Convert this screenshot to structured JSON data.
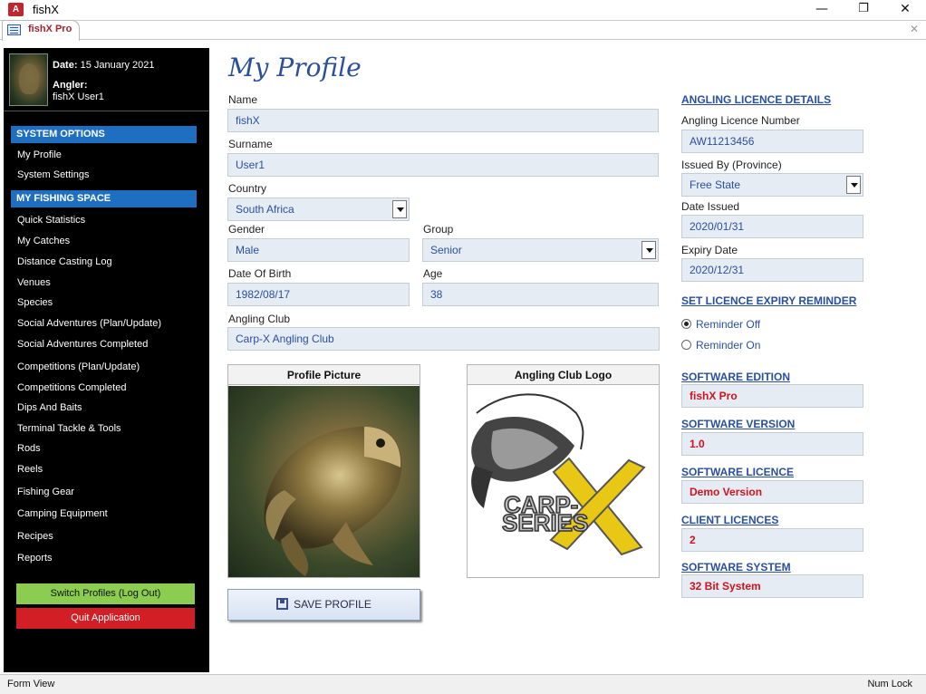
{
  "window": {
    "title": "fishX",
    "app_icon_letter": "A",
    "minimize": "—",
    "restore": "❐",
    "close": "✕"
  },
  "tab": {
    "label": "fishX Pro",
    "close": "✕"
  },
  "user": {
    "date_label": "Date:",
    "date": "15 January 2021",
    "angler_label": "Angler:",
    "angler_name": "fishX User1"
  },
  "sidebar": {
    "system_options": "SYSTEM OPTIONS",
    "system_items": [
      "My Profile",
      "System Settings"
    ],
    "fishing_space": "MY FISHING SPACE",
    "fishing_items": [
      "Quick Statistics",
      "My Catches",
      "Distance Casting Log",
      "Venues",
      "Species",
      "Social Adventures (Plan/Update)",
      "Social Adventures Completed",
      "Competitions (Plan/Update)",
      "Competitions Completed",
      "Dips And Baits",
      "Terminal Tackle & Tools",
      "Rods",
      "Reels",
      "Fishing Gear",
      "Camping Equipment",
      "Recipes",
      "Reports"
    ],
    "switch_label": "Switch Profiles (Log Out)",
    "quit_label": "Quit Application",
    "colors": {
      "section": "#1e6fc1",
      "switch": "#8ccc50",
      "quit": "#d21f26"
    }
  },
  "form": {
    "title": "My Profile",
    "name_label": "Name",
    "name": "fishX",
    "surname_label": "Surname",
    "surname": "User1",
    "country_label": "Country",
    "country": "South Africa",
    "gender_label": "Gender",
    "gender": "Male",
    "group_label": "Group",
    "group": "Senior",
    "dob_label": "Date Of Birth",
    "dob": "1982/08/17",
    "age_label": "Age",
    "age": "38",
    "club_label": "Angling Club",
    "club": "Carp-X Angling Club",
    "profile_picture_label": "Profile Picture",
    "club_logo_label": "Angling Club Logo",
    "logo_text_1": "CARP-",
    "logo_text_2": "SERIES",
    "save_label": "SAVE PROFILE"
  },
  "licence": {
    "heading": "ANGLING LICENCE DETAILS",
    "number_label": "Angling Licence Number",
    "number": "AW11213456",
    "issued_by_label": "Issued By (Province)",
    "issued_by": "Free State",
    "date_issued_label": "Date Issued",
    "date_issued": "2020/01/31",
    "expiry_label": "Expiry Date",
    "expiry": "2020/12/31",
    "reminder_heading": "SET LICENCE EXPIRY REMINDER",
    "reminder_off": "Reminder Off",
    "reminder_on": "Reminder On",
    "reminder_selected": "off"
  },
  "software": {
    "edition_heading": "SOFTWARE EDITION",
    "edition": "fishX Pro",
    "version_heading": "SOFTWARE VERSION",
    "version": "1.0",
    "licence_heading": "SOFTWARE LICENCE",
    "licence": "Demo Version",
    "clients_heading": "CLIENT LICENCES",
    "clients": "2",
    "system_heading": "SOFTWARE SYSTEM",
    "system": "32 Bit System"
  },
  "status": {
    "left": "Form View",
    "right": "Num Lock"
  }
}
